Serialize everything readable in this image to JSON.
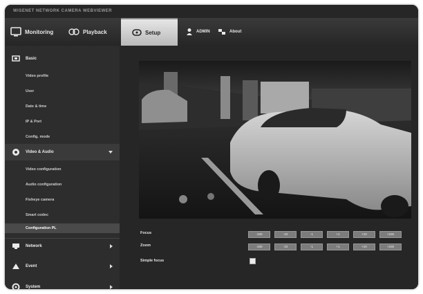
{
  "window": {
    "title": "WISENET NETWORK CAMERA WEBVIEWER"
  },
  "nav": {
    "monitoring": "Monitoring",
    "playback": "Playback",
    "setup": "Setup",
    "admin": "ADMIN",
    "about": "About"
  },
  "sidebar": {
    "basic": "Basic",
    "basic_items": [
      "Video profile",
      "User",
      "Date & time",
      "IP & Port",
      "Config. mode"
    ],
    "video_audio": "Video & Audio",
    "video_items": [
      "Video configuration",
      "Audio configuration",
      "Fisheye camera",
      "Smart codec",
      "Configuration PL"
    ],
    "active_item": "Configuration PL",
    "network": "Network",
    "event": "Event",
    "system": "System"
  },
  "controls": {
    "focus_label": "Focus",
    "zoom_label": "Zoom",
    "simple_label": "Simple focus",
    "focus_buttons": [
      "-100",
      "-10",
      "-1",
      "+1",
      "+10",
      "+100"
    ],
    "zoom_buttons": [
      "-100",
      "-10",
      "-1",
      "+1",
      "+10",
      "+100"
    ]
  },
  "colors": {
    "accent_setup": "#d0d0d0",
    "sidebar_bg": "#2d2d2d",
    "content_bg": "#262626"
  }
}
